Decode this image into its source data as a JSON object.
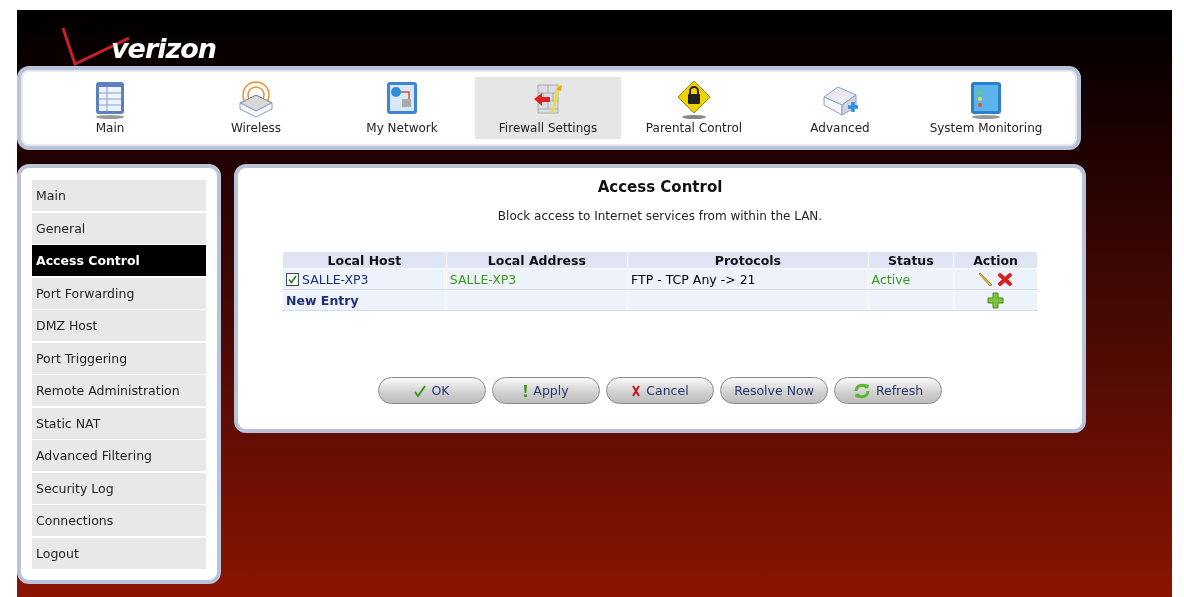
{
  "logo": {
    "text": "verizon"
  },
  "nav": [
    {
      "label": "Main",
      "selected": false
    },
    {
      "label": "Wireless",
      "selected": false
    },
    {
      "label": "My Network",
      "selected": false
    },
    {
      "label": "Firewall Settings",
      "selected": true
    },
    {
      "label": "Parental Control",
      "selected": false
    },
    {
      "label": "Advanced",
      "selected": false
    },
    {
      "label": "System Monitoring",
      "selected": false
    }
  ],
  "sidebar": {
    "items": [
      {
        "label": "Main",
        "selected": false
      },
      {
        "label": "General",
        "selected": false
      },
      {
        "label": "Access Control",
        "selected": true
      },
      {
        "label": "Port Forwarding",
        "selected": false
      },
      {
        "label": "DMZ Host",
        "selected": false
      },
      {
        "label": "Port Triggering",
        "selected": false
      },
      {
        "label": "Remote Administration",
        "selected": false
      },
      {
        "label": "Static NAT",
        "selected": false
      },
      {
        "label": "Advanced Filtering",
        "selected": false
      },
      {
        "label": "Security Log",
        "selected": false
      },
      {
        "label": "Connections",
        "selected": false
      },
      {
        "label": "Logout",
        "selected": false
      }
    ]
  },
  "content": {
    "title": "Access Control",
    "description": "Block access to Internet services from within the LAN.",
    "table": {
      "columns": [
        "Local Host",
        "Local Address",
        "Protocols",
        "Status",
        "Action"
      ],
      "rows": [
        {
          "kind": "entry",
          "checked": true,
          "local_host": "SALLE-XP3",
          "local_address": "SALLE-XP3",
          "protocols": "FTP - TCP Any -> 21",
          "status": "Active"
        },
        {
          "kind": "new",
          "label": "New Entry"
        }
      ]
    },
    "buttons": [
      "OK",
      "Apply",
      "Cancel",
      "Resolve Now",
      "Refresh"
    ]
  }
}
